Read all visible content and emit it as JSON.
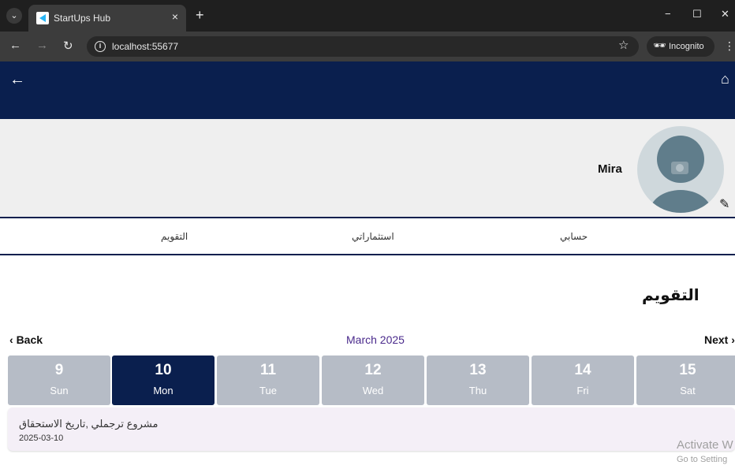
{
  "browser": {
    "tab_title": "StartUps Hub",
    "tab_close": "×",
    "new_tab": "+",
    "url": "localhost:55677",
    "incognito_label": "Incognito",
    "window_controls": {
      "minimize": "−",
      "maximize": "☐",
      "close": "✕"
    },
    "icons": [
      "tab-menu-icon",
      "back-icon",
      "forward-icon",
      "reload-icon",
      "site-info-icon",
      "star-icon",
      "incognito-icon",
      "kebab-menu-icon"
    ]
  },
  "app": {
    "colors": {
      "primary": "#0a1f4e",
      "day_inactive": "#b6bcc6",
      "event_bg": "#f4eff7",
      "month_label": "#4a2a8c"
    },
    "profile": {
      "name": "Mira"
    },
    "tabs": [
      {
        "label": "حسابي"
      },
      {
        "label": "استثماراتي"
      },
      {
        "label": "التقويم"
      }
    ],
    "section_title": "التقويم",
    "calendar": {
      "back_label": "Back",
      "month_label": "March 2025",
      "next_label": "Next",
      "days": [
        {
          "num": "9",
          "name": "Sun"
        },
        {
          "num": "10",
          "name": "Mon",
          "selected": true
        },
        {
          "num": "11",
          "name": "Tue"
        },
        {
          "num": "12",
          "name": "Wed"
        },
        {
          "num": "13",
          "name": "Thu"
        },
        {
          "num": "14",
          "name": "Fri"
        },
        {
          "num": "15",
          "name": "Sat"
        }
      ]
    },
    "events": [
      {
        "title": "مشروع ترجملي ,تاريخ الاستحقاق",
        "date": "2025-03-10"
      }
    ]
  },
  "os_watermark": {
    "line1": "Activate W",
    "line2": "Go to Setting"
  }
}
